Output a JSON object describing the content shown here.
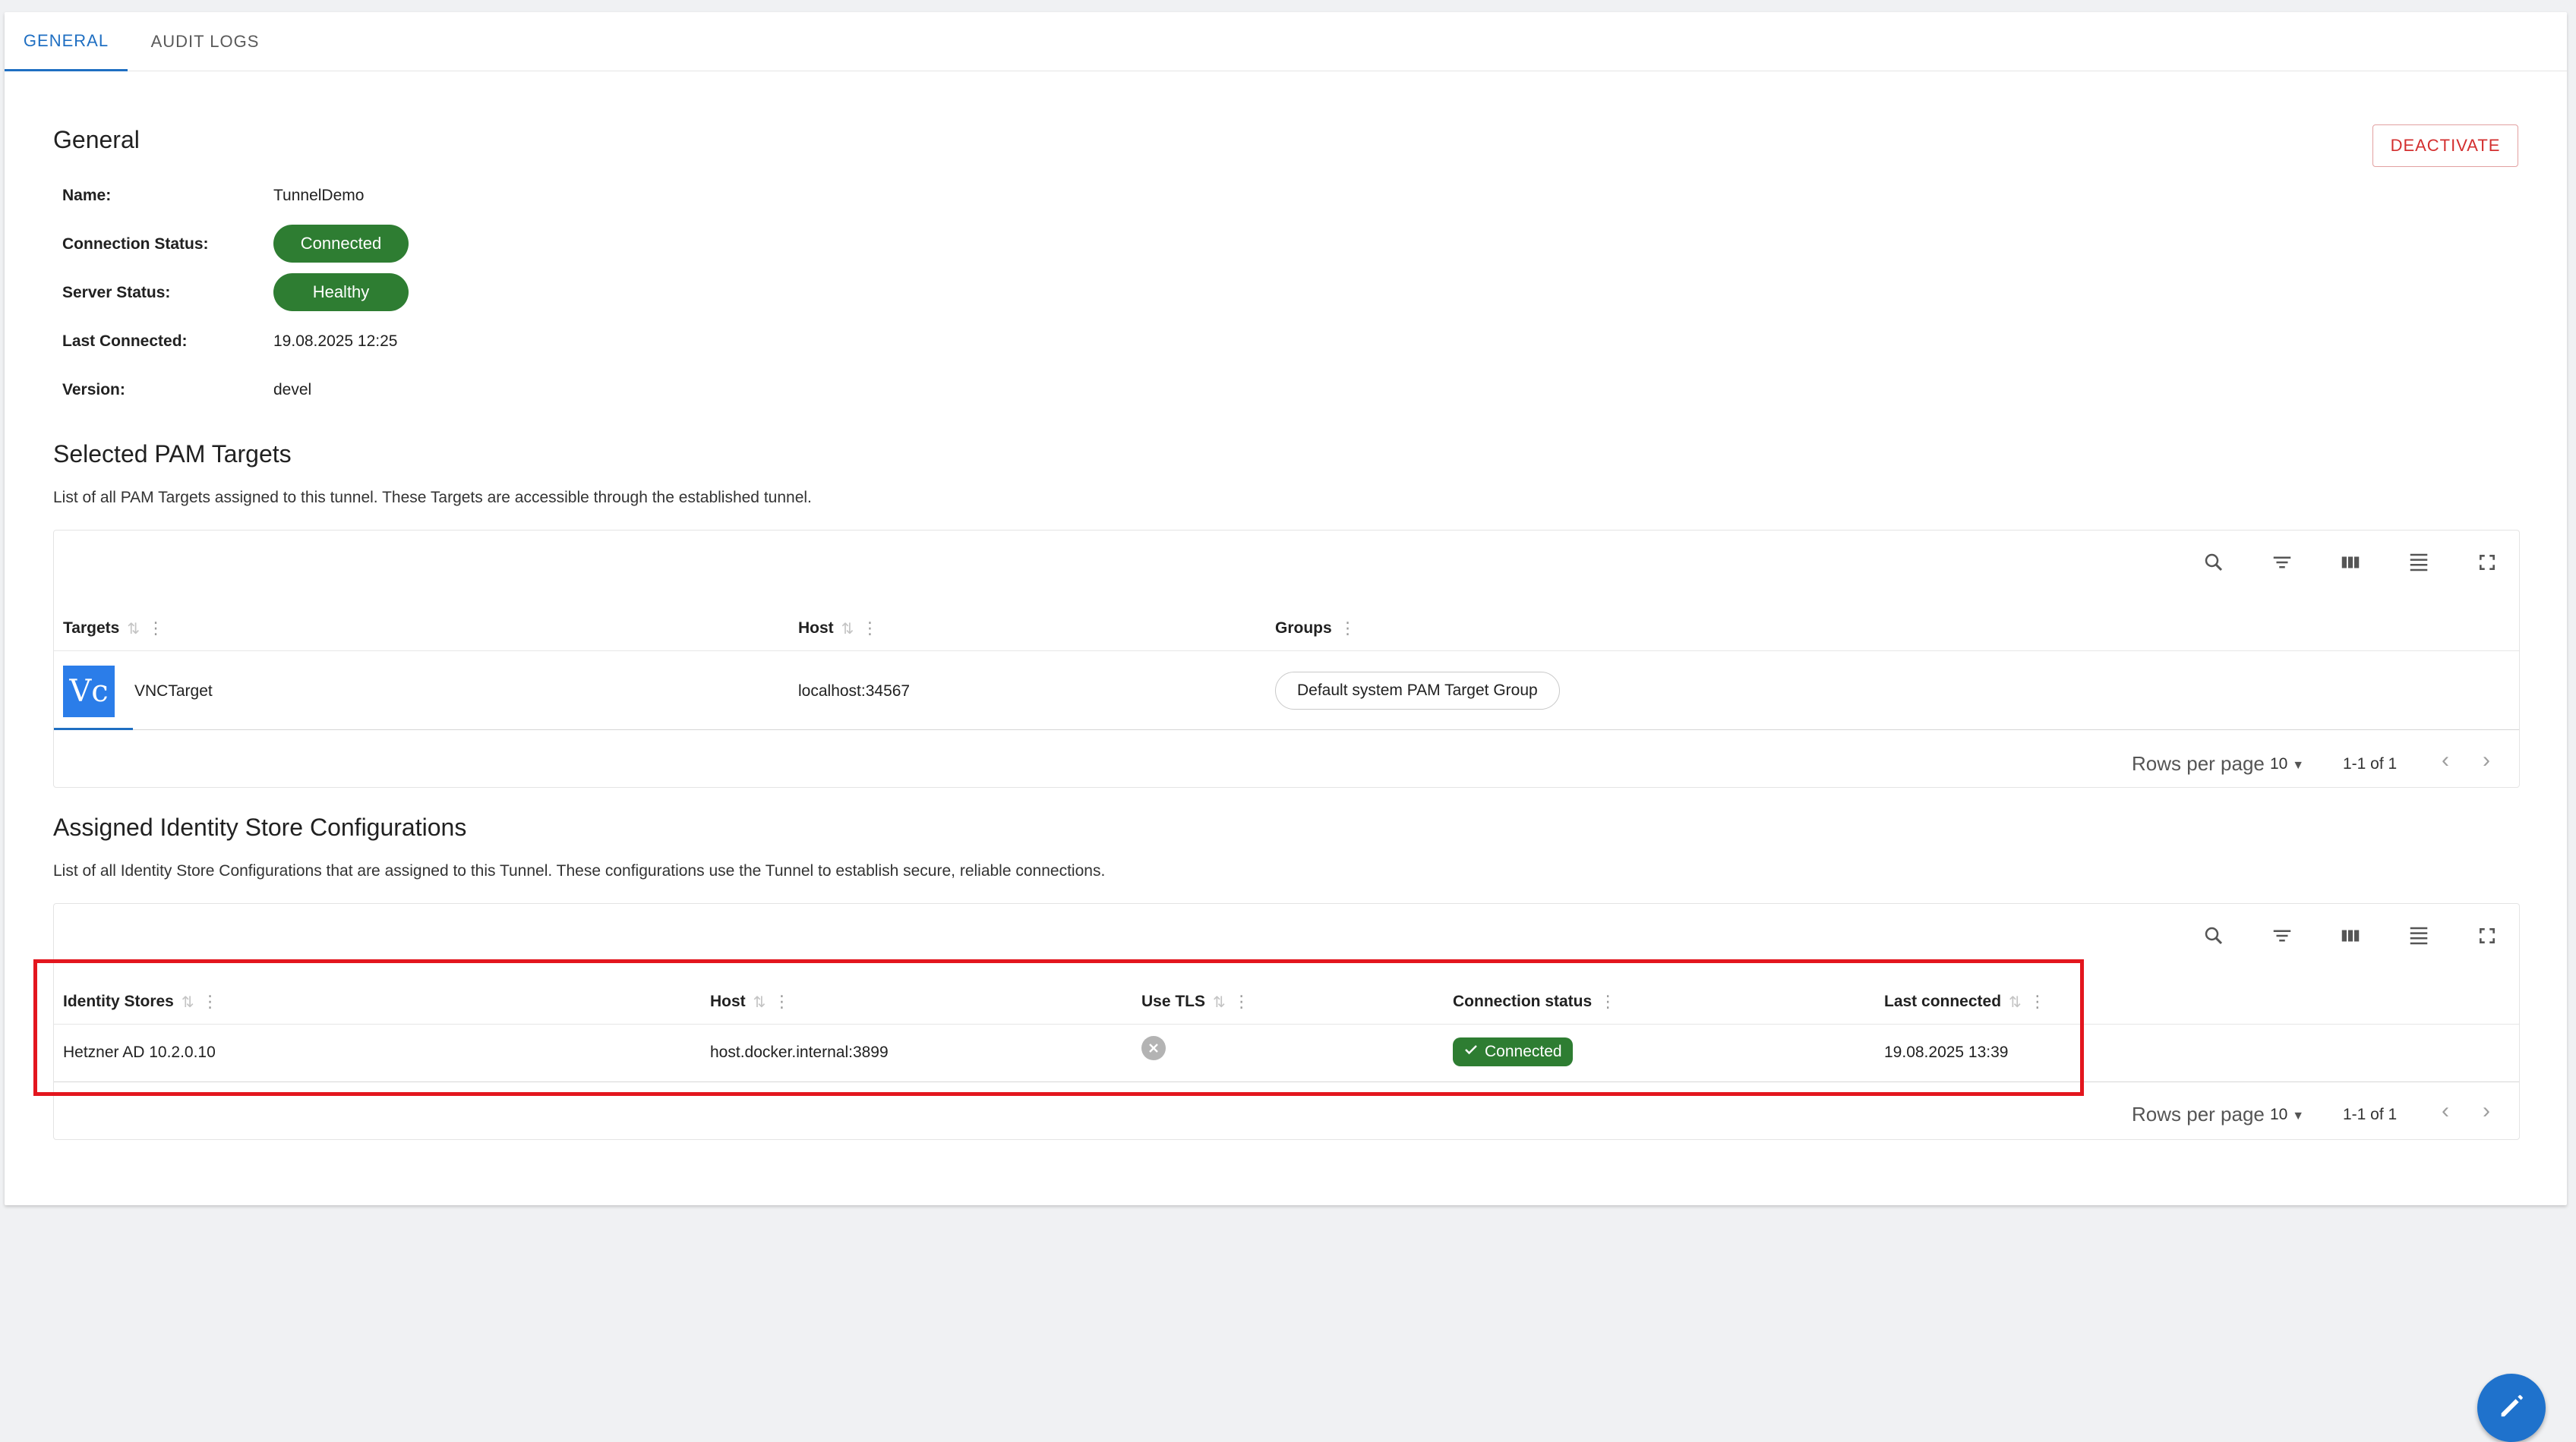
{
  "tabs": [
    {
      "label": "GENERAL",
      "active": true
    },
    {
      "label": "AUDIT LOGS",
      "active": false
    }
  ],
  "general": {
    "title": "General",
    "deactivate_label": "DEACTIVATE",
    "fields": {
      "name_label": "Name:",
      "name_value": "TunnelDemo",
      "connection_status_label": "Connection Status:",
      "connection_status_value": "Connected",
      "server_status_label": "Server Status:",
      "server_status_value": "Healthy",
      "last_connected_label": "Last Connected:",
      "last_connected_value": "19.08.2025 12:25",
      "version_label": "Version:",
      "version_value": "devel"
    }
  },
  "pam_targets": {
    "title": "Selected PAM Targets",
    "description": "List of all PAM Targets assigned to this tunnel. These Targets are accessible through the established tunnel.",
    "columns": [
      "Targets",
      "Host",
      "Groups"
    ],
    "rows": [
      {
        "logo_text": "Vc",
        "target": "VNCTarget",
        "host": "localhost:34567",
        "group": "Default system PAM Target Group"
      }
    ],
    "footer": {
      "rows_per_page_label": "Rows per page",
      "rows_per_page_value": "10",
      "range": "1-1 of 1"
    }
  },
  "identity_stores": {
    "title": "Assigned Identity Store Configurations",
    "description": "List of all Identity Store Configurations that are assigned to this Tunnel. These configurations use the Tunnel to establish secure, reliable connections.",
    "columns": [
      "Identity Stores",
      "Host",
      "Use TLS",
      "Connection status",
      "Last connected"
    ],
    "rows": [
      {
        "identity_store": "Hetzner AD 10.2.0.10",
        "host": "host.docker.internal:3899",
        "use_tls": false,
        "connection_status": "Connected",
        "last_connected": "19.08.2025 13:39"
      }
    ],
    "footer": {
      "rows_per_page_label": "Rows per page",
      "rows_per_page_value": "10",
      "range": "1-1 of 1"
    }
  },
  "colors": {
    "accent": "#1f6fc2",
    "success": "#2e7d32",
    "danger": "#d32f2f",
    "highlight": "#e3161e"
  },
  "icons": [
    "search-icon",
    "filter-icon",
    "columns-icon",
    "density-icon",
    "fullscreen-icon",
    "sort-icon",
    "column-menu-icon",
    "chevron-left-icon",
    "chevron-right-icon",
    "dropdown-arrow-icon",
    "close-circle-icon",
    "check-icon",
    "edit-icon"
  ]
}
